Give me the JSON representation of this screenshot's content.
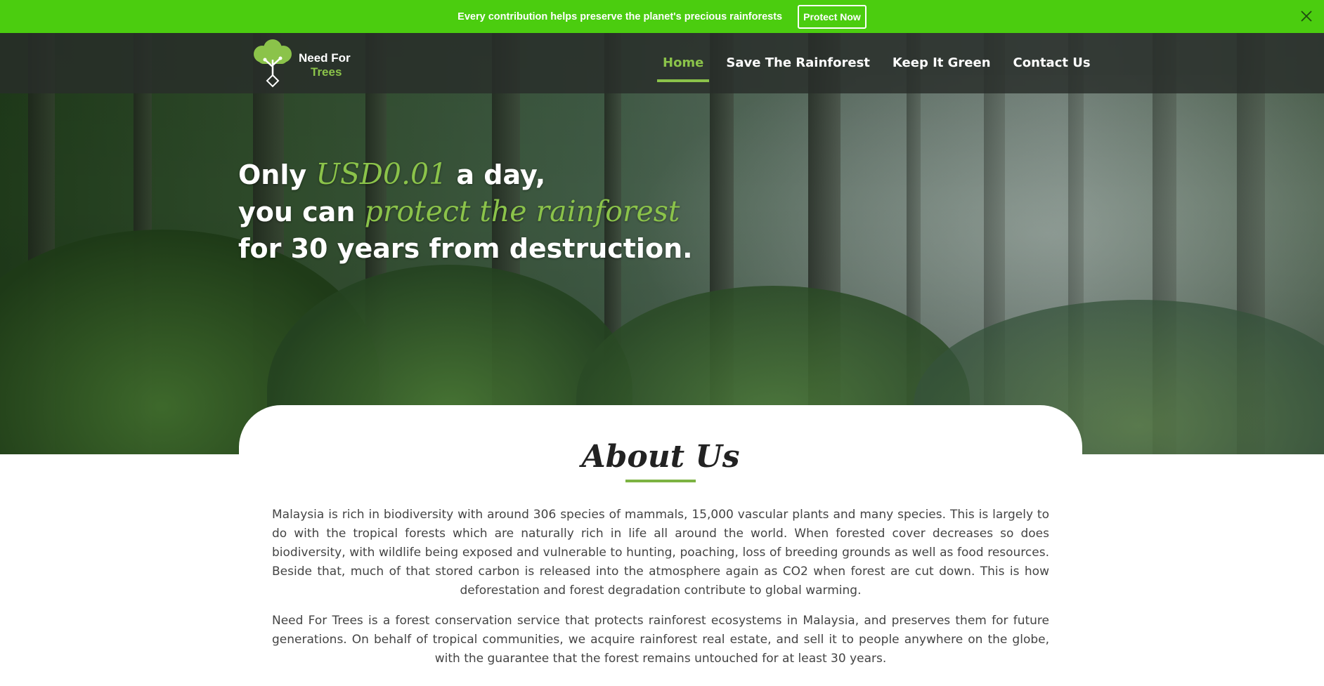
{
  "promo": {
    "text": "Every contribution helps preserve the planet's precious rainforests",
    "button": "Protect Now",
    "close_icon": "close-icon"
  },
  "brand": {
    "line1": "Need For",
    "line2": "Trees",
    "logo_icon": "tree-logo-icon"
  },
  "nav": {
    "items": [
      {
        "label": "Home",
        "active": true
      },
      {
        "label": "Save The Rainforest",
        "active": false
      },
      {
        "label": "Keep It Green",
        "active": false
      },
      {
        "label": "Contact Us",
        "active": false
      }
    ]
  },
  "hero": {
    "line1_a": "Only ",
    "line1_accent": "USD0.01",
    "line1_b": " a day,",
    "line2_a": "you can ",
    "line2_accent": "protect the rainforest",
    "line3": "for 30 years from destruction."
  },
  "about": {
    "title": "About Us",
    "paragraphs": [
      "Malaysia is rich in biodiversity with around 306 species of mammals, 15,000 vascular plants and many species. This is largely to do with the tropical forests which are naturally rich in life all around the world. When forested cover decreases so does biodiversity, with wildlife being exposed and vulnerable to hunting, poaching, loss of breeding grounds as well as food resources. Beside that, much of that stored carbon is released into the atmosphere again as CO2 when forest are cut down. This is how deforestation and forest degradation contribute to global warming.",
      "Need For Trees is a forest conservation service that protects rainforest ecosystems in Malaysia, and preserves them for future generations. On behalf of tropical communities, we acquire rainforest real estate, and sell it to people anywhere on the globe, with the guarantee that the forest remains untouched for at least 30 years."
    ]
  },
  "colors": {
    "promo_bg": "#4bcd0f",
    "accent": "#8bc34a"
  }
}
